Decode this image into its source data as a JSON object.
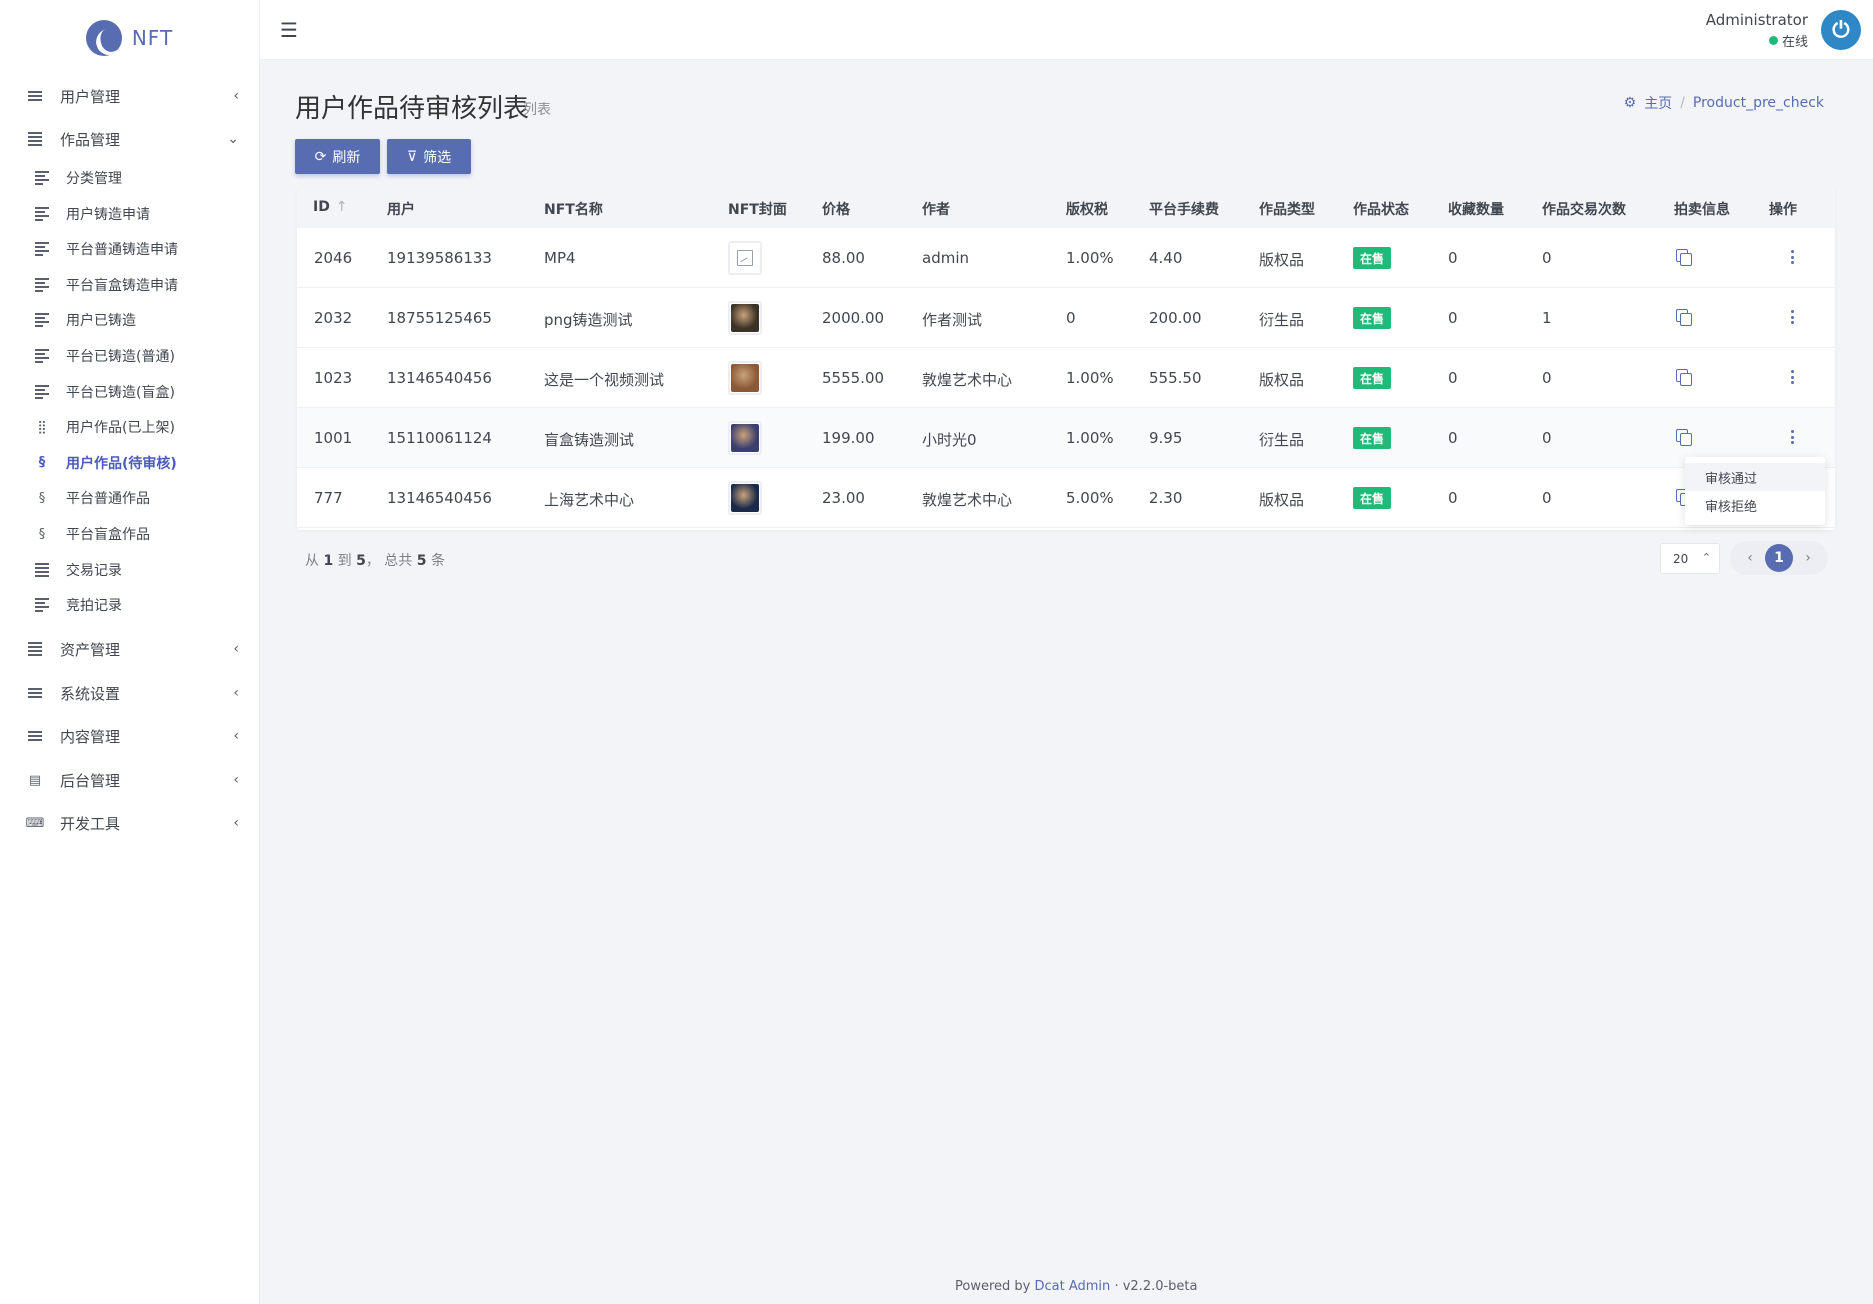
{
  "brand": {
    "name": "NFT"
  },
  "sidebar": {
    "top_before": [
      {
        "label": "用户管理",
        "icon": "bars-icon",
        "chevron": "‹"
      },
      {
        "label": "作品管理",
        "icon": "list-icon",
        "chevron": "⌄"
      }
    ],
    "sub_items": [
      {
        "label": "分类管理",
        "icon": "align-left-icon",
        "active": false
      },
      {
        "label": "用户铸造申请",
        "icon": "align-left-icon",
        "active": false
      },
      {
        "label": "平台普通铸造申请",
        "icon": "align-left-icon",
        "active": false
      },
      {
        "label": "平台盲盒铸造申请",
        "icon": "align-left-icon",
        "active": false
      },
      {
        "label": "用户已铸造",
        "icon": "align-left-icon",
        "active": false
      },
      {
        "label": "平台已铸造(普通)",
        "icon": "align-left-icon",
        "active": false
      },
      {
        "label": "平台已铸造(盲盒)",
        "icon": "align-left-icon",
        "active": false
      },
      {
        "label": "用户作品(已上架)",
        "icon": "grid-icon",
        "active": false
      },
      {
        "label": "用户作品(待审核)",
        "icon": "fingerprint-icon",
        "active": true
      },
      {
        "label": "平台普通作品",
        "icon": "fingerprint-icon",
        "active": false
      },
      {
        "label": "平台盲盒作品",
        "icon": "fingerprint-icon",
        "active": false
      },
      {
        "label": "交易记录",
        "icon": "list-icon",
        "active": false
      },
      {
        "label": "竞拍记录",
        "icon": "align-left-icon",
        "active": false
      }
    ],
    "top_after": [
      {
        "label": "资产管理",
        "icon": "list-icon",
        "chevron": "‹"
      },
      {
        "label": "系统设置",
        "icon": "bars-icon",
        "chevron": "‹"
      },
      {
        "label": "内容管理",
        "icon": "bars-icon",
        "chevron": "‹"
      },
      {
        "label": "后台管理",
        "icon": "server-icon",
        "chevron": "‹"
      },
      {
        "label": "开发工具",
        "icon": "keyboard-icon",
        "chevron": "‹"
      }
    ]
  },
  "topbar": {
    "user_name": "Administrator",
    "status": "在线"
  },
  "page": {
    "title": "用户作品待审核列表",
    "description": "列表",
    "breadcrumb": {
      "home": "主页",
      "current": "Product_pre_check"
    },
    "refresh_label": "刷新",
    "filter_label": "筛选"
  },
  "table": {
    "columns": [
      "ID",
      "用户",
      "NFT名称",
      "NFT封面",
      "价格",
      "作者",
      "版权税",
      "平台手续费",
      "作品类型",
      "作品状态",
      "收藏数量",
      "作品交易次数",
      "拍卖信息",
      "操作"
    ],
    "id_sort_icon": "↑",
    "rows": [
      {
        "id": "2046",
        "user": "19139586133",
        "name": "MP4",
        "cover": "broken",
        "price": "88.00",
        "author": "admin",
        "royalty": "1.00%",
        "fee": "4.40",
        "type": "版权品",
        "status": "在售",
        "favorites": "0",
        "trades": "0"
      },
      {
        "id": "2032",
        "user": "18755125465",
        "name": "png铸造测试",
        "cover": "#3a3226",
        "price": "2000.00",
        "author": "作者测试",
        "royalty": "0",
        "fee": "200.00",
        "type": "衍生品",
        "status": "在售",
        "favorites": "0",
        "trades": "1"
      },
      {
        "id": "1023",
        "user": "13146540456",
        "name": "这是一个视频测试",
        "cover": "#8a5a36",
        "price": "5555.00",
        "author": "敦煌艺术中心",
        "royalty": "1.00%",
        "fee": "555.50",
        "type": "版权品",
        "status": "在售",
        "favorites": "0",
        "trades": "0"
      },
      {
        "id": "1001",
        "user": "15110061124",
        "name": "盲盒铸造测试",
        "cover": "#3b3f6e",
        "price": "199.00",
        "author": "小时光0",
        "royalty": "1.00%",
        "fee": "9.95",
        "type": "衍生品",
        "status": "在售",
        "favorites": "0",
        "trades": "0"
      },
      {
        "id": "777",
        "user": "13146540456",
        "name": "上海艺术中心",
        "cover": "#1b2a4a",
        "price": "23.00",
        "author": "敦煌艺术中心",
        "royalty": "5.00%",
        "fee": "2.30",
        "type": "版权品",
        "status": "在售",
        "favorites": "0",
        "trades": "0"
      }
    ]
  },
  "dropdown": {
    "approve": "审核通过",
    "reject": "审核拒绝"
  },
  "pagination": {
    "summary_from": "从",
    "summary_start": "1",
    "summary_to": "到",
    "summary_end": "5",
    "summary_total_prefix": "，  总共",
    "summary_total": "5",
    "summary_unit": "条",
    "per_page": "20",
    "current_page": "1",
    "prev": "‹",
    "next": "›"
  },
  "footer": {
    "prefix": "Powered by",
    "link": "Dcat Admin",
    "sep": "·",
    "version": "v2.2.0-beta"
  },
  "colors": {
    "primary": "#586cb1",
    "success": "#21b978",
    "background": "#f3f4f8"
  }
}
